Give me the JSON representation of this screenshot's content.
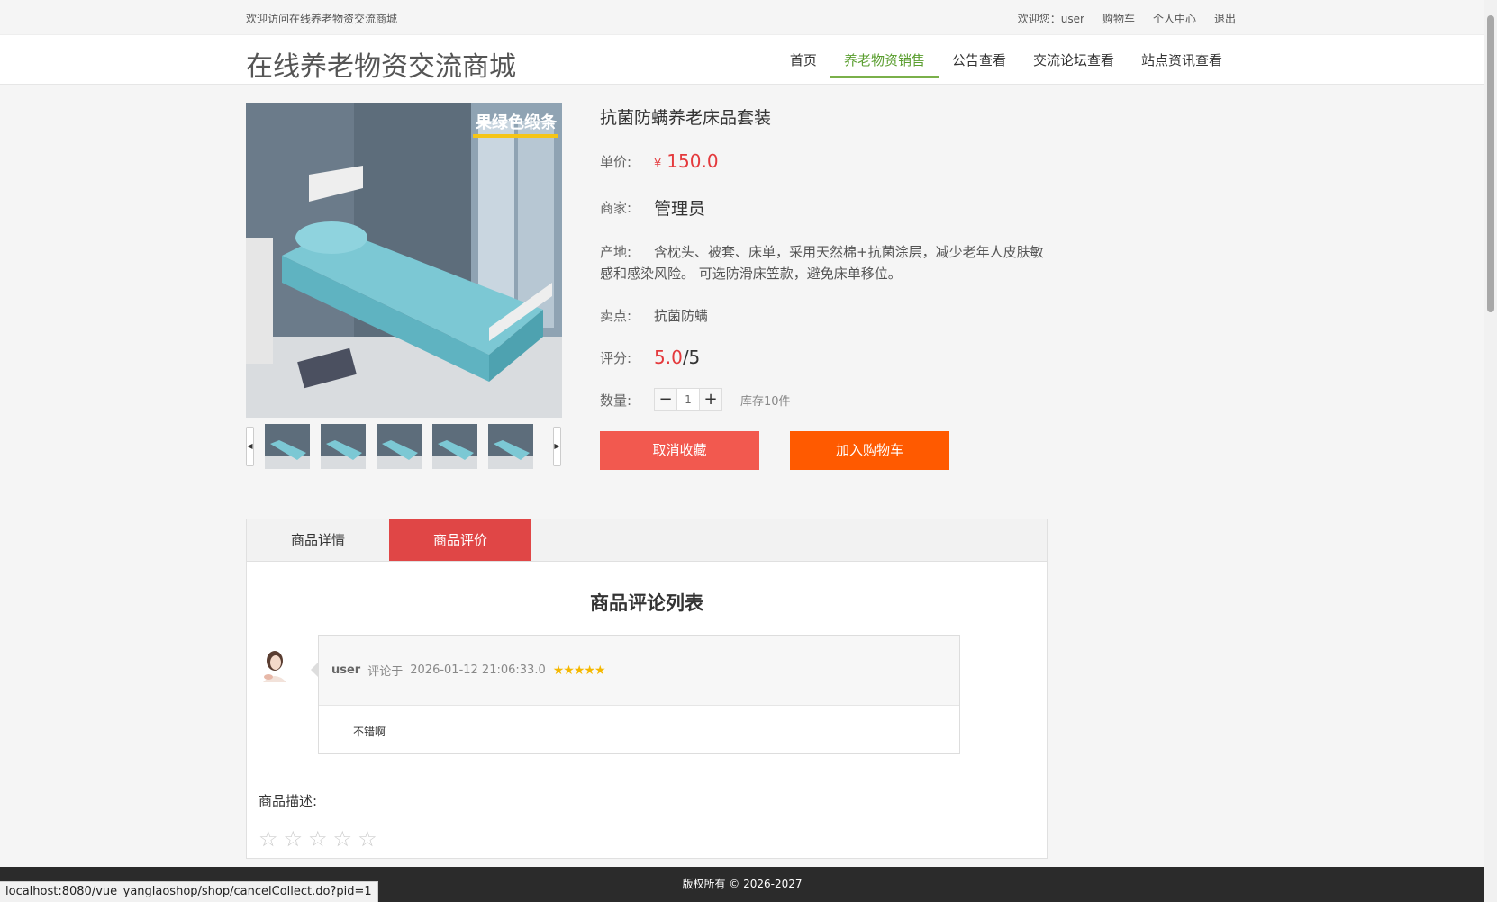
{
  "topbar": {
    "welcome": "欢迎访问在线养老物资交流商城",
    "greeting": "欢迎您：user",
    "cart": "购物车",
    "profile": "个人中心",
    "logout": "退出"
  },
  "header": {
    "logo": "在线养老物资交流商城",
    "nav": [
      "首页",
      "养老物资销售",
      "公告查看",
      "交流论坛查看",
      "站点资讯查看"
    ]
  },
  "product": {
    "image_banner": "果绿色缎条",
    "title": "抗菌防螨养老床品套装",
    "price_label": "单价:",
    "currency": "¥",
    "price": "150.0",
    "seller_label": "商家:",
    "seller": "管理员",
    "origin_label": "产地:",
    "origin": "含枕头、被套、床单，采用天然棉+抗菌涂层，减少老年人皮肤敏感和感染风险。 可选防滑床笠款，避免床单移位。",
    "selling_label": "卖点:",
    "selling_point": "抗菌防螨",
    "rating_label": "评分:",
    "rating": "5.0",
    "rating_max": "/5",
    "qty_label": "数量:",
    "qty_minus": "−",
    "qty": "1",
    "qty_plus": "+",
    "stock": "库存10件",
    "uncollect": "取消收藏",
    "add_cart": "加入购物车"
  },
  "tabs": [
    "商品详情",
    "商品评价"
  ],
  "reviews": {
    "title": "商品评论列表",
    "items": [
      {
        "user": "user",
        "prefix": "评论于",
        "date": "2026-01-12 21:06:33.0",
        "stars": "★★★★★",
        "text": "不错啊"
      }
    ]
  },
  "description": {
    "label": "商品描述:",
    "stars": "☆☆☆☆☆"
  },
  "footer": "版权所有 © 2026-2027",
  "statusbar": "localhost:8080/vue_yanglaoshop/shop/cancelCollect.do?pid=1",
  "colors": {
    "accent_green": "#5a9e2f",
    "price_red": "#e4393c",
    "tab_red": "#e04646",
    "cart_orange": "#ff5a00",
    "uncollect_red": "#f2594f"
  }
}
